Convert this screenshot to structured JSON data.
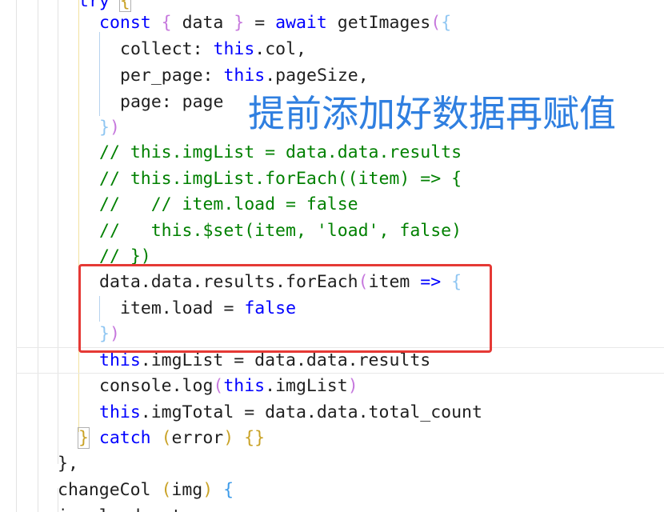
{
  "editor": {
    "lines": [
      [
        {
          "t": "try ",
          "c": "k"
        },
        {
          "t": "{",
          "c": "b1"
        }
      ],
      [
        {
          "t": "const ",
          "c": "k"
        },
        {
          "t": "{ ",
          "c": "b2"
        },
        {
          "t": "data ",
          "c": "txt"
        },
        {
          "t": "} ",
          "c": "b2"
        },
        {
          "t": "= ",
          "c": "txt"
        },
        {
          "t": "await ",
          "c": "k"
        },
        {
          "t": "getImages",
          "c": "txt"
        },
        {
          "t": "(",
          "c": "b2"
        },
        {
          "t": "{",
          "c": "b3l"
        }
      ],
      [
        {
          "t": "collect: ",
          "c": "txt"
        },
        {
          "t": "this",
          "c": "k"
        },
        {
          "t": ".col,",
          "c": "txt"
        }
      ],
      [
        {
          "t": "per_page: ",
          "c": "txt"
        },
        {
          "t": "this",
          "c": "k"
        },
        {
          "t": ".pageSize,",
          "c": "txt"
        }
      ],
      [
        {
          "t": "page: page",
          "c": "txt"
        }
      ],
      [
        {
          "t": "}",
          "c": "b3l"
        },
        {
          "t": ")",
          "c": "b2"
        }
      ],
      [
        {
          "t": "// this.imgList = data.data.results",
          "c": "cm"
        }
      ],
      [
        {
          "t": "// this.imgList.forEach((item) => {",
          "c": "cm"
        }
      ],
      [
        {
          "t": "//   // item.load = false",
          "c": "cm"
        }
      ],
      [
        {
          "t": "//   this.$set(item, 'load', false)",
          "c": "cm"
        }
      ],
      [
        {
          "t": "// })",
          "c": "cm"
        }
      ],
      [
        {
          "t": "data.data.results.forEach",
          "c": "txt"
        },
        {
          "t": "(",
          "c": "b2"
        },
        {
          "t": "item ",
          "c": "txt"
        },
        {
          "t": "=> ",
          "c": "k"
        },
        {
          "t": "{",
          "c": "b3l"
        }
      ],
      [
        {
          "t": "item.load = ",
          "c": "txt"
        },
        {
          "t": "false",
          "c": "k"
        }
      ],
      [
        {
          "t": "}",
          "c": "b3l"
        },
        {
          "t": ")",
          "c": "b2"
        }
      ],
      [
        {
          "t": "this",
          "c": "k"
        },
        {
          "t": ".imgList = data.data.results",
          "c": "txt"
        }
      ],
      [
        {
          "t": "console.log",
          "c": "txt"
        },
        {
          "t": "(",
          "c": "b2"
        },
        {
          "t": "this",
          "c": "k"
        },
        {
          "t": ".imgList",
          "c": "txt"
        },
        {
          "t": ")",
          "c": "b2"
        }
      ],
      [
        {
          "t": "this",
          "c": "k"
        },
        {
          "t": ".imgTotal = data.data.total_count",
          "c": "txt"
        }
      ],
      [
        {
          "t": "}",
          "c": "b1"
        },
        {
          "t": " catch ",
          "c": "k"
        },
        {
          "t": "(",
          "c": "b1"
        },
        {
          "t": "error",
          "c": "txt"
        },
        {
          "t": ") ",
          "c": "b1"
        },
        {
          "t": "{}",
          "c": "b1"
        }
      ],
      [
        {
          "t": "},",
          "c": "txt"
        }
      ],
      [
        {
          "t": "changeCol ",
          "c": "txt"
        },
        {
          "t": "(",
          "c": "b1"
        },
        {
          "t": "img",
          "c": "txt"
        },
        {
          "t": ") ",
          "c": "b1"
        },
        {
          "t": "{",
          "c": "b3"
        }
      ],
      [
        {
          "t": "img.load = true",
          "c": "txt"
        }
      ]
    ]
  },
  "annotation": {
    "text": "提前添加好数据再赋值",
    "color": "#2f7fe0"
  },
  "highlight": {
    "color": "#e53935"
  }
}
